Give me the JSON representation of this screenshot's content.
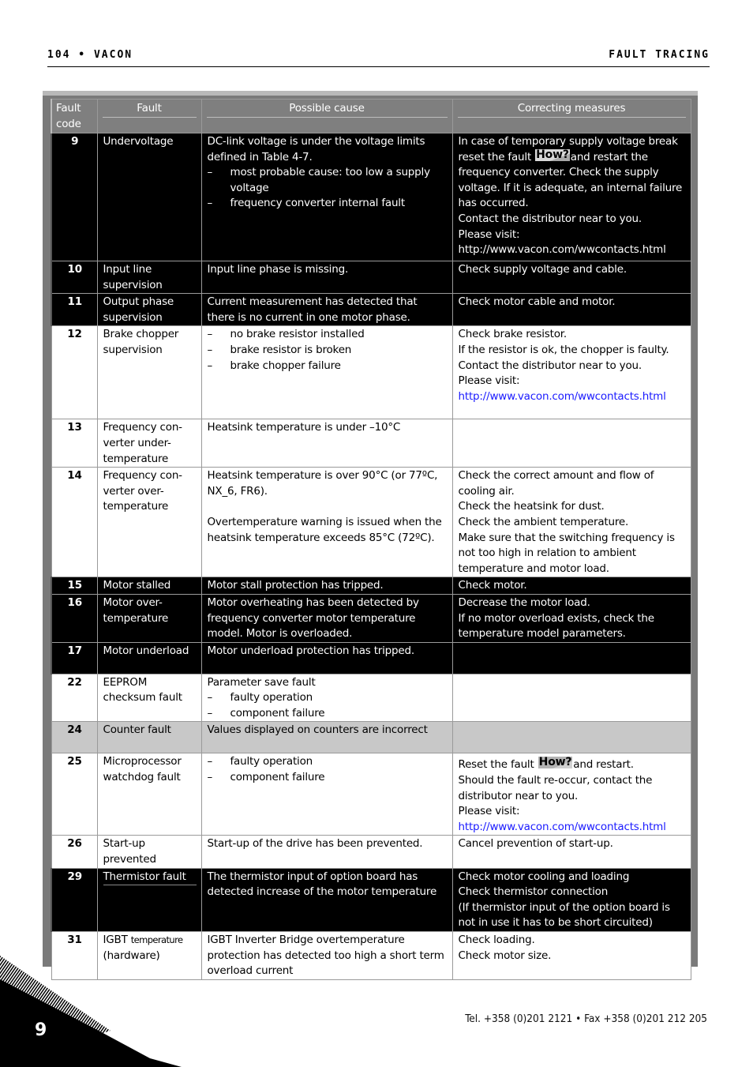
{
  "header": {
    "left": "104 • VACON",
    "right": "FAULT TRACING"
  },
  "table": {
    "columns": [
      "Fault code",
      "Fault",
      "Possible cause",
      "Correcting measures"
    ],
    "how_label": "How?",
    "rows": [
      {
        "style": "dark",
        "code": "9",
        "fault": "Undervoltage",
        "cause_lines": [
          "DC-link voltage is under the voltage limits defined in Table 4-7."
        ],
        "cause_bullets": [
          "most probable cause: too low a supply voltage",
          "frequency converter internal fault"
        ],
        "measures_pre": "In case of temporary supply voltage break reset the fault",
        "measures_post": "and restart the frequency converter. Check the supply voltage. If it is adequate, an internal failure has occurred.",
        "measures_lines": [
          "Contact the distributor near to you.",
          "Please visit:"
        ],
        "url": "http://www.vacon.com/wwcontacts.html"
      },
      {
        "style": "dark",
        "code": "10",
        "fault": "Input line supervision",
        "cause": "Input line phase is missing.",
        "measures": "Check supply voltage and cable."
      },
      {
        "style": "dark",
        "code": "11",
        "fault": "Output phase supervision",
        "cause": "Current measurement has detected that there is no current in one motor phase.",
        "measures": "Check motor cable and motor."
      },
      {
        "style": "light",
        "code": "12",
        "fault": "Brake chopper supervision",
        "cause_bullets": [
          "no brake resistor  installed",
          "brake resistor is broken",
          "brake chopper failure"
        ],
        "measures_lines": [
          "Check brake resistor.",
          "If the resistor is ok, the chopper is faulty. Contact the distributor near to you.",
          "Please visit:"
        ],
        "url": "http://www.vacon.com/wwcontacts.html"
      },
      {
        "style": "light",
        "code": "13",
        "fault": "Frequency con-verter under-temperature",
        "cause": "Heatsink temperature is under –10°C",
        "measures": ""
      },
      {
        "style": "light",
        "code": "14",
        "fault": "Frequency con-verter over-temperature",
        "cause_p1": "Heatsink temperature is over 90°C (or 77ºC, NX_6, FR6).",
        "cause_p2": "Overtemperature warning is issued when the heatsink temperature exceeds 85°C (72ºC).",
        "measures_lines": [
          "Check the correct amount and flow of cooling air.",
          "Check the heatsink for dust.",
          "Check the ambient temperature.",
          "Make sure that the switching frequency is not too high in relation to ambient temperature and motor load."
        ]
      },
      {
        "style": "dark",
        "code": "15",
        "fault": "Motor stalled",
        "cause": "Motor stall protection has tripped.",
        "measures": "Check motor."
      },
      {
        "style": "dark",
        "code": "16",
        "fault": "Motor over-temperature",
        "cause": "Motor overheating has been detected by frequency converter motor temperature model. Motor is overloaded.",
        "measures_lines": [
          "Decrease the motor load.",
          "If no motor overload exists, check the temperature model parameters."
        ]
      },
      {
        "style": "dark",
        "code": "17",
        "fault": "Motor underload",
        "cause": "Motor underload protection has tripped.",
        "measures": ""
      },
      {
        "style": "light",
        "code": "22",
        "fault": "EEPROM checksum fault",
        "cause_lines": [
          "Parameter save fault"
        ],
        "cause_bullets": [
          "faulty operation",
          "component failure"
        ],
        "measures": ""
      },
      {
        "style": "grey",
        "code": "24",
        "fault": "Counter fault",
        "cause": "Values displayed on counters are incorrect",
        "measures": ""
      },
      {
        "style": "light",
        "code": "25",
        "fault": "Microprocessor watchdog fault",
        "cause_bullets": [
          "faulty operation",
          "component failure"
        ],
        "measures_pre": "Reset the fault",
        "measures_post": "and restart.",
        "measures_lines": [
          "Should the fault re-occur, contact the distributor near to you.",
          "Please visit:"
        ],
        "url": "http://www.vacon.com/wwcontacts.html"
      },
      {
        "style": "light",
        "code": "26",
        "fault": "Start-up prevented",
        "cause": "Start-up of the drive has been prevented.",
        "measures": "Cancel prevention of start-up."
      },
      {
        "style": "dark",
        "code": "29",
        "fault": "Thermistor fault",
        "cause": "The thermistor input of option board has detected increase of the motor temperature",
        "measures_lines": [
          "Check motor cooling and loading",
          "Check thermistor connection",
          "(If thermistor input of the option board is not in use it has to be short circuited)"
        ]
      },
      {
        "style": "light",
        "code": "31",
        "fault_a": "IGBT",
        "fault_b": "temperature",
        "fault_c": "(hardware)",
        "cause": "IGBT Inverter Bridge overtemperature protection has detected too high a short term overload current",
        "measures_lines": [
          "Check loading.",
          "Check motor size."
        ]
      }
    ]
  },
  "footer": {
    "contact": "Tel. +358 (0)201 2121 • Fax +358 (0)201 212 205",
    "chapter_number": "9"
  }
}
